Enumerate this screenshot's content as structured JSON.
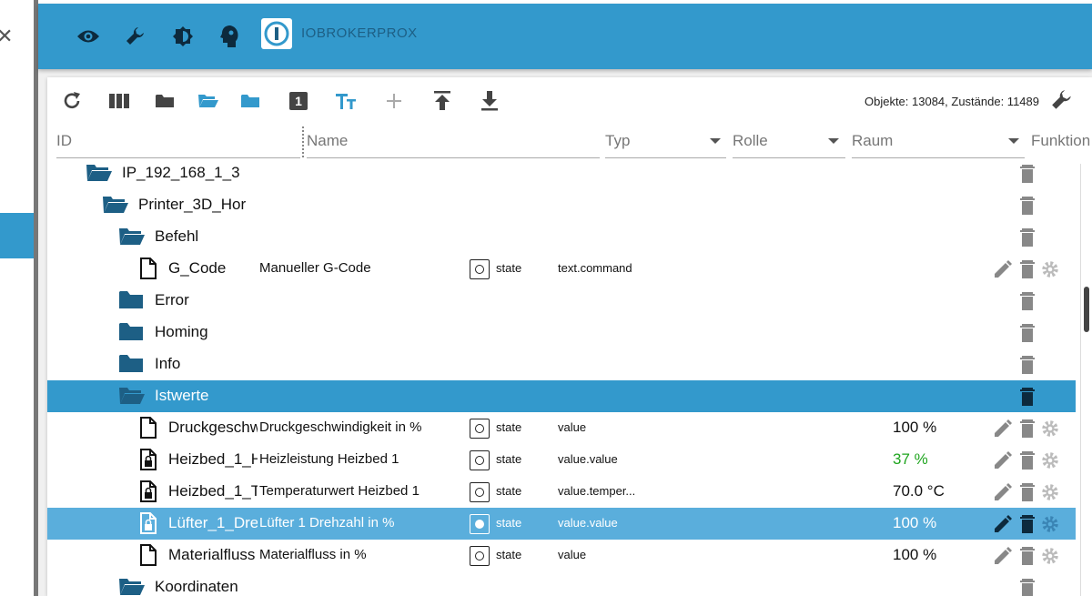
{
  "app": {
    "name": "IOBROKERPROX"
  },
  "topbar": {
    "icons": [
      "eye-icon",
      "wrench-icon",
      "brightness-icon",
      "head-icon"
    ]
  },
  "toolbar": {
    "buttons": [
      "refresh-icon",
      "columns-icon",
      "folder-icon",
      "folder-open-icon",
      "folder-blue-icon",
      "one-icon",
      "text-size-icon",
      "add-icon",
      "upload-icon",
      "download-icon"
    ],
    "one_label": "1",
    "stats": "Objekte: 13084, Zustände: 11489"
  },
  "columns": {
    "id": "ID",
    "name": "Name",
    "typ": "Typ",
    "rolle": "Rolle",
    "raum": "Raum",
    "funktion": "Funktion"
  },
  "rows": [
    {
      "id": "IP_192_168_1_3",
      "kind": "folder-open",
      "name": "",
      "typ": "",
      "rolle": "",
      "value": ""
    },
    {
      "id": "Printer_3D_Hor",
      "kind": "folder-open",
      "name": "",
      "typ": "",
      "rolle": "",
      "value": ""
    },
    {
      "id": "Befehl",
      "kind": "folder-open",
      "name": "",
      "typ": "",
      "rolle": "",
      "value": ""
    },
    {
      "id": "G_Code",
      "kind": "file",
      "name": "Manueller G-Code",
      "typ": "state",
      "rolle": "text.command",
      "value": ""
    },
    {
      "id": "Error",
      "kind": "folder",
      "name": "",
      "typ": "",
      "rolle": "",
      "value": ""
    },
    {
      "id": "Homing",
      "kind": "folder",
      "name": "",
      "typ": "",
      "rolle": "",
      "value": ""
    },
    {
      "id": "Info",
      "kind": "folder",
      "name": "",
      "typ": "",
      "rolle": "",
      "value": ""
    },
    {
      "id": "Istwerte",
      "kind": "folder-open",
      "name": "",
      "typ": "",
      "rolle": "",
      "value": ""
    },
    {
      "id": "Druckgeschw",
      "kind": "file",
      "name": "Druckgeschwindigkeit in %",
      "typ": "state",
      "rolle": "value",
      "value": "100 %"
    },
    {
      "id": "Heizbed_1_H",
      "kind": "file-lock",
      "name": "Heizleistung Heizbed 1",
      "typ": "state",
      "rolle": "value.value",
      "value": "37 %"
    },
    {
      "id": "Heizbed_1_T",
      "kind": "file-lock",
      "name": "Temperaturwert Heizbed 1",
      "typ": "state",
      "rolle": "value.temper...",
      "value": "70.0 °C"
    },
    {
      "id": "Lüfter_1_Dre",
      "kind": "file-lock",
      "name": "Lüfter 1 Drehzahl in %",
      "typ": "state",
      "rolle": "value.value",
      "value": "100 %"
    },
    {
      "id": "Materialfluss",
      "kind": "file",
      "name": "Materialfluss in %",
      "typ": "state",
      "rolle": "value",
      "value": "100 %"
    },
    {
      "id": "Koordinaten",
      "kind": "folder-open",
      "name": "",
      "typ": "",
      "rolle": "",
      "value": ""
    }
  ],
  "colors": {
    "accent": "#3399cc",
    "folder": "#1d5f85",
    "green": "#1fa51f"
  }
}
